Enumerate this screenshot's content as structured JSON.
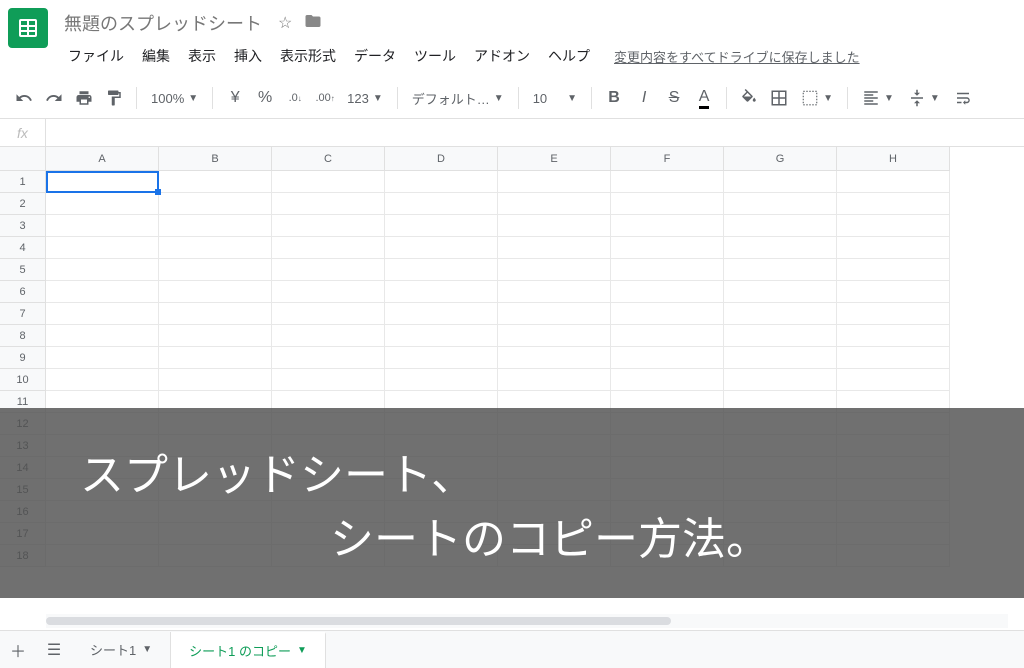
{
  "header": {
    "doc_title": "無題のスプレッドシート",
    "menus": [
      "ファイル",
      "編集",
      "表示",
      "挿入",
      "表示形式",
      "データ",
      "ツール",
      "アドオン",
      "ヘルプ"
    ],
    "save_status": "変更内容をすべてドライブに保存しました"
  },
  "toolbar": {
    "zoom": "100%",
    "currency": "¥",
    "percent": "%",
    "dec_less": ".0",
    "dec_more": ".00",
    "format_num": "123",
    "font": "デフォルト…",
    "font_size": "10",
    "bold": "B",
    "italic": "I",
    "strike": "S",
    "text_color": "A"
  },
  "formula": {
    "fx": "fx",
    "value": ""
  },
  "grid": {
    "columns": [
      "A",
      "B",
      "C",
      "D",
      "E",
      "F",
      "G",
      "H"
    ],
    "rows": [
      "1",
      "2",
      "3",
      "4",
      "5",
      "6",
      "7",
      "8",
      "9",
      "10",
      "11",
      "12",
      "13",
      "14",
      "15",
      "16",
      "17",
      "18"
    ],
    "active": "A1"
  },
  "overlay": {
    "line1": "スプレッドシート、",
    "line2": "シートのコピー方法。"
  },
  "tabs": {
    "sheet1": "シート1",
    "sheet2": "シート1 のコピー"
  }
}
